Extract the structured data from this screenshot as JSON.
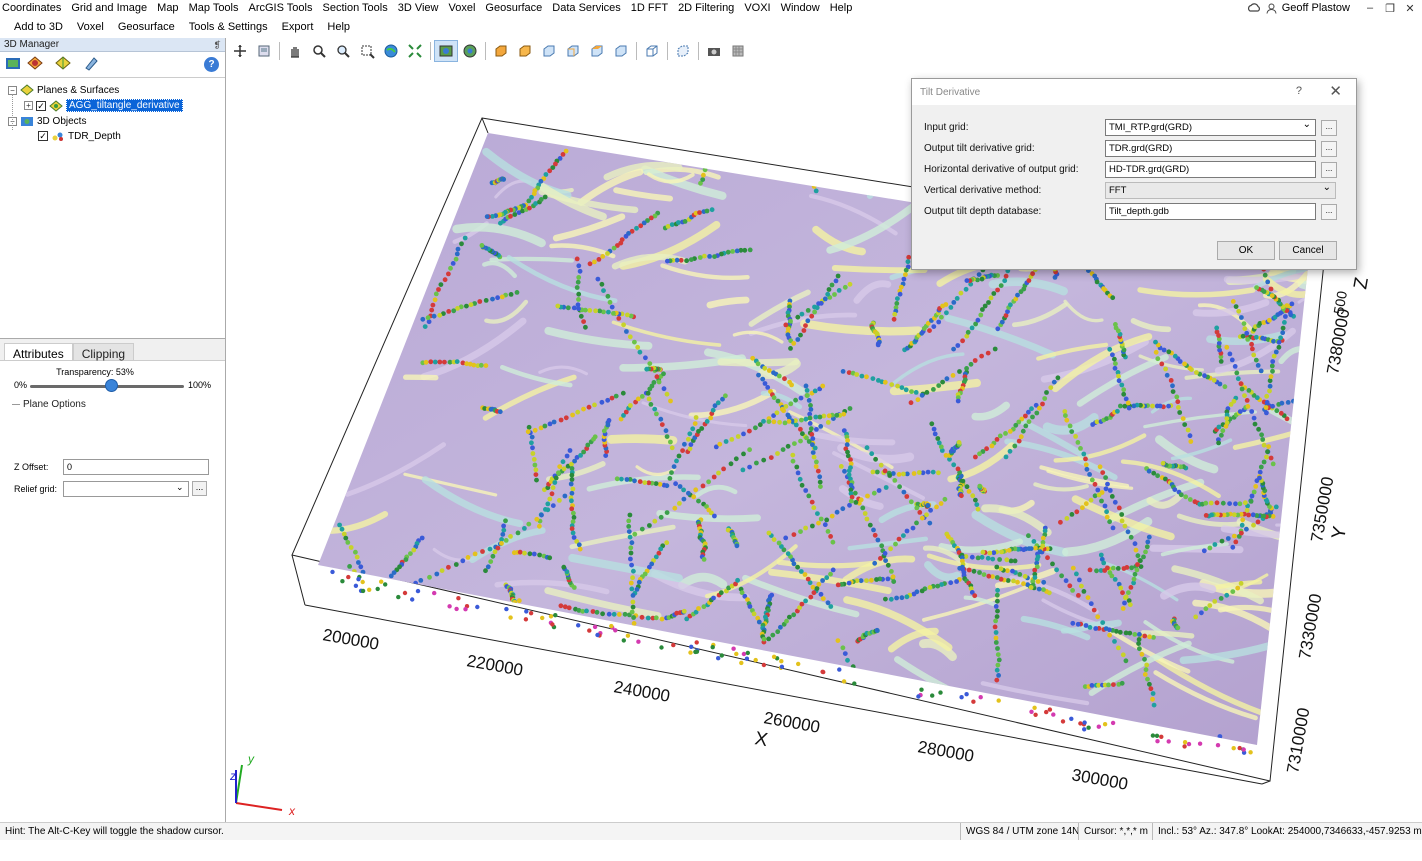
{
  "menu_top": [
    "Coordinates",
    "Grid and Image",
    "Map",
    "Map Tools",
    "ArcGIS Tools",
    "Section Tools",
    "3D View",
    "Voxel",
    "Geosurface",
    "Data Services",
    "1D FFT",
    "2D Filtering",
    "VOXI",
    "Window",
    "Help"
  ],
  "user": "Geoff Plastow",
  "menu_second": [
    "Add to 3D",
    "Voxel",
    "Geosurface",
    "Tools & Settings",
    "Export",
    "Help"
  ],
  "manager": {
    "title": "3D Manager",
    "pin": "❡"
  },
  "tree": {
    "planes_label": "Planes & Surfaces",
    "selected_item": "AGG_tiltangle_derivative",
    "objects_label": "3D Objects",
    "object_item": "TDR_Depth"
  },
  "attributes": {
    "tab_attributes": "Attributes",
    "tab_clipping": "Clipping",
    "transparency_label": "Transparency: 53%",
    "transparency_value": 0.53,
    "min_label": "0%",
    "max_label": "100%",
    "plane_options": "Plane Options",
    "z_offset_label": "Z Offset:",
    "z_offset_value": "0",
    "relief_label": "Relief grid:",
    "relief_value": ""
  },
  "dialog": {
    "title": "Tilt Derivative",
    "help": "?",
    "close": "✕",
    "fields": [
      {
        "label": "Input grid:",
        "value": "TMI_RTP.grd(GRD)",
        "dropdown": true,
        "browse": true
      },
      {
        "label": "Output tilt derivative grid:",
        "value": "TDR.grd(GRD)",
        "dropdown": false,
        "browse": true
      },
      {
        "label": "Horizontal derivative of output grid:",
        "value": "HD-TDR.grd(GRD)",
        "dropdown": false,
        "browse": true
      },
      {
        "label": "Vertical derivative method:",
        "value": "FFT",
        "dropdown": true,
        "browse": false
      },
      {
        "label": "Output tilt depth database:",
        "value": "Tilt_depth.gdb",
        "dropdown": false,
        "browse": true
      }
    ],
    "ok": "OK",
    "cancel": "Cancel"
  },
  "axes": {
    "x_label": "X",
    "y_label": "Y",
    "z_label": "Z",
    "x_ticks": [
      "200000",
      "220000",
      "240000",
      "260000",
      "280000",
      "300000"
    ],
    "y_ticks": [
      "7310000",
      "7330000",
      "7350000",
      "7380000"
    ],
    "z_tick": "500"
  },
  "status": {
    "hint": "Hint: The Alt-C-Key will toggle the shadow cursor.",
    "projection": "WGS 84 / UTM zone 14N",
    "cursor": "Cursor: *,*,* m",
    "view": "Incl.: 53° Az.: 347.8° LookAt: 254000,7346633,-457.9253 m"
  },
  "colors": {
    "selection": "#0a64d8",
    "accent": "#3a84d9"
  }
}
